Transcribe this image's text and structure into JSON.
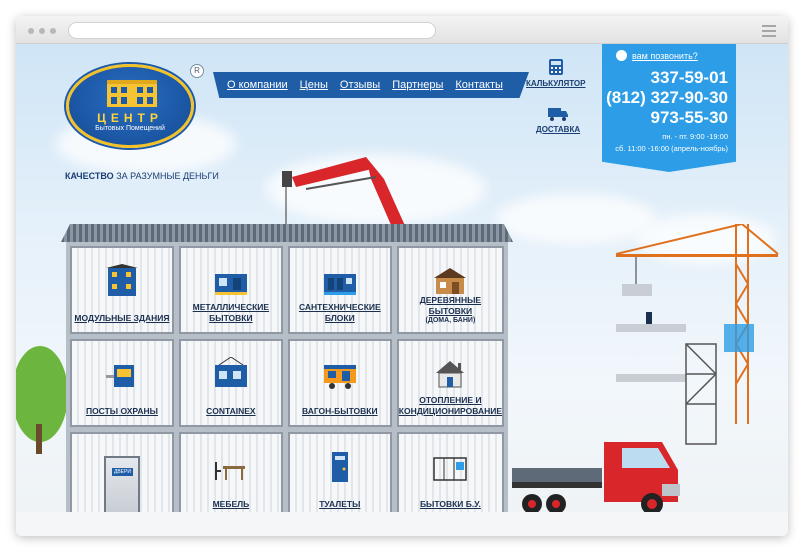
{
  "logo": {
    "title": "ЦЕНТР",
    "subtitle": "Бытовых Помещений",
    "registered": "R"
  },
  "tagline": {
    "bold": "КАЧЕСТВО",
    "rest": " ЗА РАЗУМНЫЕ ДЕНЬГИ"
  },
  "nav": {
    "items": [
      "О компании",
      "Цены",
      "Отзывы",
      "Партнеры",
      "Контакты"
    ]
  },
  "side": {
    "calculator": "КАЛЬКУЛЯТОР",
    "delivery": "ДОСТАВКА"
  },
  "contacts": {
    "callme": "вам позвонить?",
    "phones": [
      "337-59-01",
      "(812) 327-90-30",
      "973-55-30"
    ],
    "hours_weekday": "пн. - пт. 9:00 -19:00",
    "hours_saturday": "сб. 11:00 -16:00 (апрель-ноябрь)"
  },
  "catalog": {
    "items": [
      {
        "label": "МОДУЛЬНЫЕ ЗДАНИЯ",
        "note": "",
        "icon": "modular-building-icon"
      },
      {
        "label": "МЕТАЛЛИЧЕСКИЕ БЫТОВКИ",
        "note": "",
        "icon": "metal-cabin-icon"
      },
      {
        "label": "САНТЕХНИЧЕСКИЕ БЛОКИ",
        "note": "",
        "icon": "sanitary-block-icon"
      },
      {
        "label": "ДЕРЕВЯННЫЕ БЫТОВКИ",
        "note": "(ДОМА, БАНИ)",
        "icon": "wooden-cabin-icon"
      },
      {
        "label": "ПОСТЫ ОХРАНЫ",
        "note": "",
        "icon": "guard-post-icon"
      },
      {
        "label": "CONTAINEX",
        "note": "",
        "icon": "containex-icon"
      },
      {
        "label": "ВАГОН-БЫТОВКИ",
        "note": "",
        "icon": "wagon-cabin-icon"
      },
      {
        "label": "ОТОПЛЕНИЕ И КОНДИЦИОНИРОВАНИЕ",
        "note": "",
        "icon": "heating-icon"
      },
      {
        "label": "",
        "note": "",
        "icon": "door-icon",
        "door_label": "ДВЕРИ"
      },
      {
        "label": "МЕБЕЛЬ",
        "note": "",
        "icon": "furniture-icon"
      },
      {
        "label": "ТУАЛЕТЫ",
        "note": "",
        "icon": "toilet-icon"
      },
      {
        "label": "БЫТОВКИ Б.У.",
        "note": "",
        "icon": "used-cabin-icon"
      }
    ]
  },
  "colors": {
    "brand_blue": "#1f5ea6",
    "phone_blue": "#2c9de6",
    "logo_yellow": "#f3c22b",
    "crane_red": "#d8262b"
  }
}
